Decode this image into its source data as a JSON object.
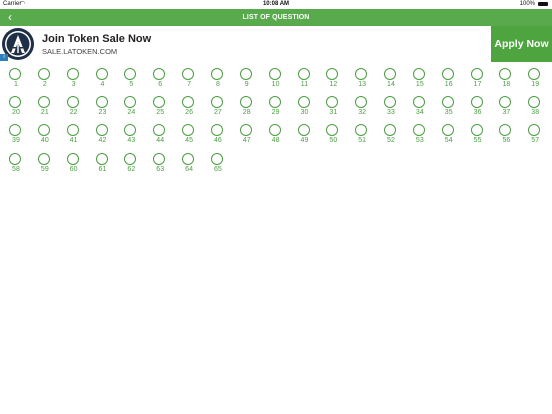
{
  "status_bar": {
    "carrier": "Carrier",
    "time": "10:08 AM",
    "battery": "100%"
  },
  "nav": {
    "back_icon": "chevron-left-icon",
    "title": "LIST OF QUESTION"
  },
  "ad": {
    "title": "Join Token Sale Now",
    "url": "SALE.LATOKEN.COM",
    "button": "Apply Now",
    "logo_icon": "latoken-logo"
  },
  "questions": [
    "1",
    "2",
    "3",
    "4",
    "5",
    "6",
    "7",
    "8",
    "9",
    "10",
    "11",
    "12",
    "13",
    "14",
    "15",
    "16",
    "17",
    "18",
    "19",
    "20",
    "21",
    "22",
    "23",
    "24",
    "25",
    "26",
    "27",
    "28",
    "29",
    "30",
    "31",
    "32",
    "33",
    "34",
    "35",
    "36",
    "37",
    "38",
    "39",
    "40",
    "41",
    "42",
    "43",
    "44",
    "45",
    "46",
    "47",
    "48",
    "49",
    "50",
    "51",
    "52",
    "53",
    "54",
    "55",
    "56",
    "57",
    "58",
    "59",
    "60",
    "61",
    "62",
    "63",
    "64",
    "65"
  ],
  "colors": {
    "nav_green": "#59a94d",
    "accent_green": "#4a9e41"
  }
}
